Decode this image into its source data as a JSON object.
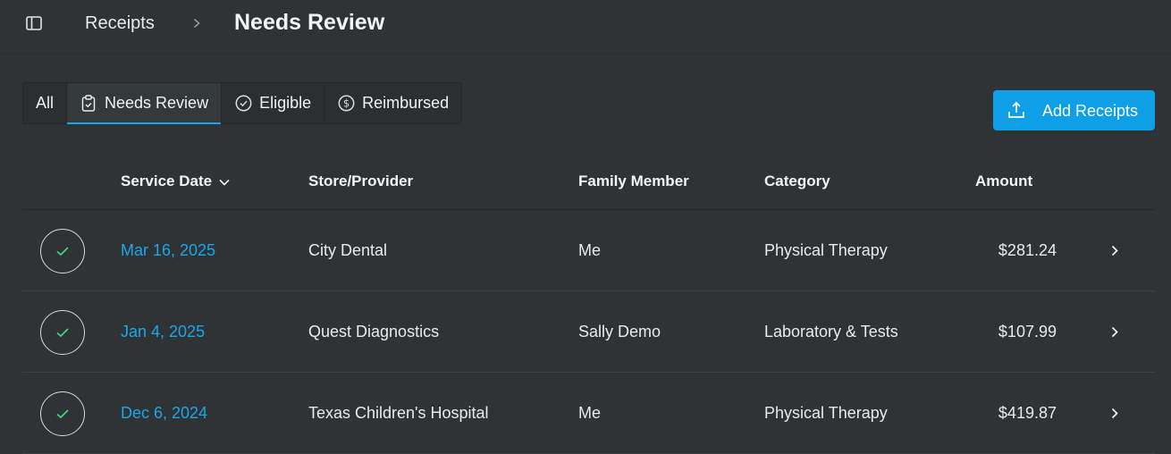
{
  "header": {
    "breadcrumb_root": "Receipts",
    "title": "Needs Review"
  },
  "tabs": [
    {
      "label": "All",
      "icon": null,
      "active": false
    },
    {
      "label": "Needs Review",
      "icon": "clipboard-check-icon",
      "active": true
    },
    {
      "label": "Eligible",
      "icon": "circle-check-icon",
      "active": false
    },
    {
      "label": "Reimbursed",
      "icon": "dollar-circle-icon",
      "active": false
    }
  ],
  "actions": {
    "add_receipts_label": "Add Receipts"
  },
  "table": {
    "columns": {
      "service_date": "Service Date",
      "store": "Store/Provider",
      "member": "Family Member",
      "category": "Category",
      "amount": "Amount"
    },
    "rows": [
      {
        "date": "Mar 16, 2025",
        "store": "City Dental",
        "member": "Me",
        "category": "Physical Therapy",
        "amount": "$281.24"
      },
      {
        "date": "Jan 4, 2025",
        "store": "Quest Diagnostics",
        "member": "Sally Demo",
        "category": "Laboratory & Tests",
        "amount": "$107.99"
      },
      {
        "date": "Dec 6, 2024",
        "store": "Texas Children's Hospital",
        "member": "Me",
        "category": "Physical Therapy",
        "amount": "$419.87"
      }
    ]
  },
  "colors": {
    "background": "#2f3336",
    "accent": "#1aa7e8",
    "button": "#0f9fe6",
    "check": "#3ddc84"
  }
}
